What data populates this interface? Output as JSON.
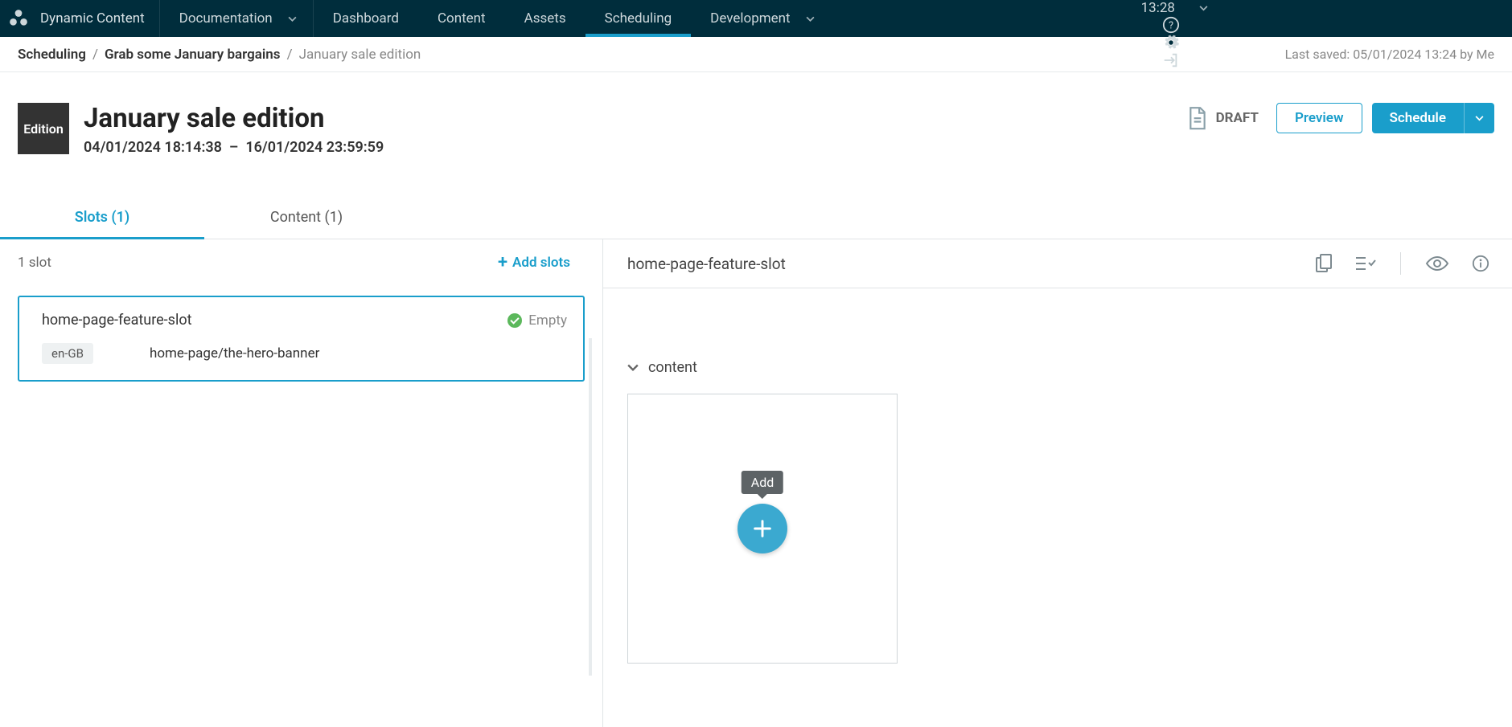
{
  "brand": {
    "name": "Dynamic Content"
  },
  "nav": {
    "documentation": "Documentation",
    "dashboard": "Dashboard",
    "content": "Content",
    "assets": "Assets",
    "scheduling": "Scheduling",
    "development": "Development"
  },
  "clock": {
    "time": "13:28"
  },
  "breadcrumb": {
    "root": "Scheduling",
    "event": "Grab some January bargains",
    "current": "January sale edition",
    "saved": "Last saved: 05/01/2024 13:24 by Me"
  },
  "edition": {
    "chip": "Edition",
    "title": "January sale edition",
    "start": "04/01/2024 18:14:38",
    "end": "16/01/2024 23:59:59",
    "sep": "–",
    "status": "DRAFT",
    "preview": "Preview",
    "schedule": "Schedule"
  },
  "tabs": {
    "slots": "Slots (1)",
    "content": "Content (1)"
  },
  "left": {
    "count": "1 slot",
    "add": "Add slots",
    "slot": {
      "name": "home-page-feature-slot",
      "status": "Empty",
      "locale": "en-GB",
      "path": "home-page/the-hero-banner"
    }
  },
  "right": {
    "title": "home-page-feature-slot",
    "section": "content",
    "tooltip": "Add"
  }
}
